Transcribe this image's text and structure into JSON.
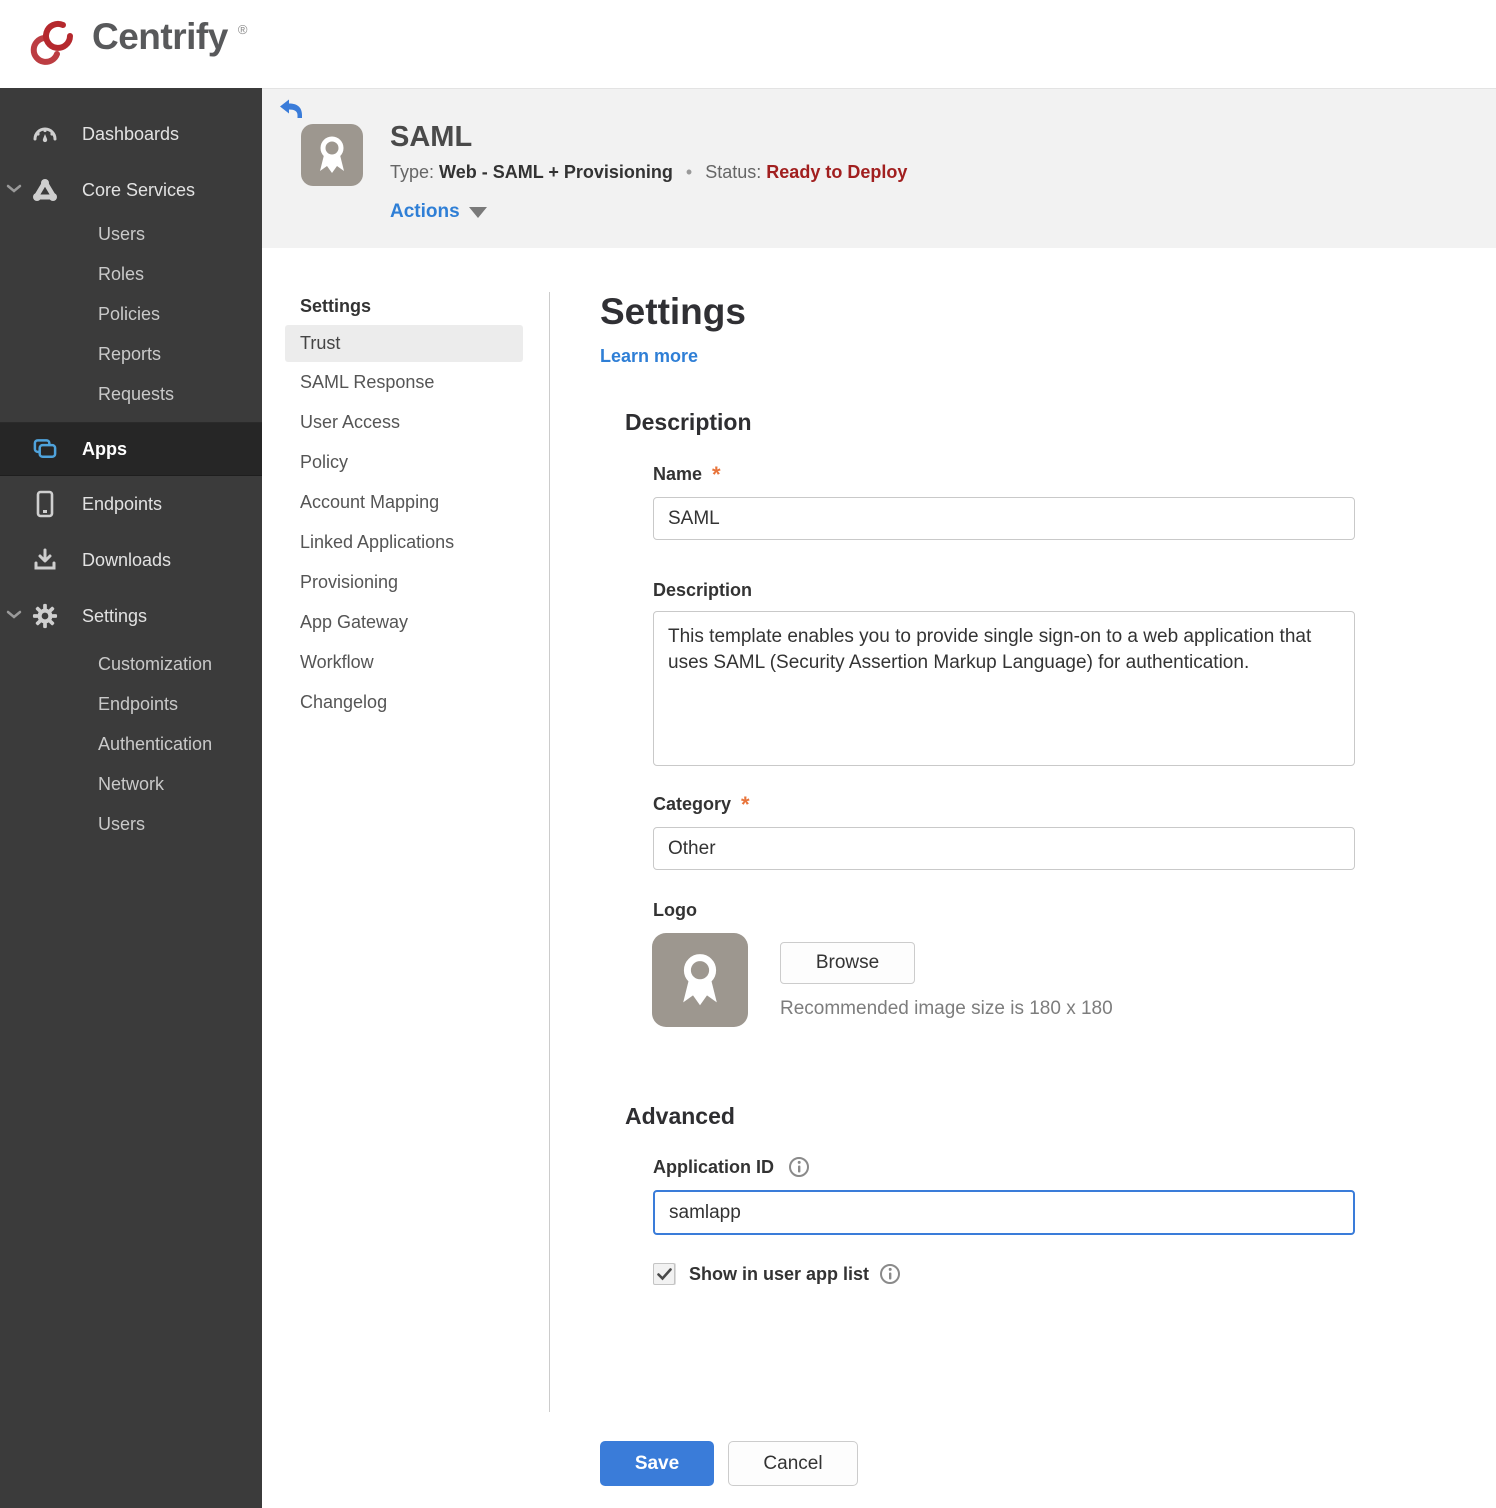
{
  "brand": {
    "name": "Centrify",
    "reg": "®"
  },
  "colors": {
    "accent_blue": "#3a7cd9",
    "link_blue": "#2f7fd6",
    "status_red": "#a11f1f",
    "required_orange": "#e8743b",
    "sidebar_bg": "#3b3b3b",
    "sidebar_selected_bg": "#262626",
    "apps_icon_blue": "#4fa3dc",
    "band_bg": "#f2f2f2",
    "logo_gray": "#9d978f"
  },
  "sidebar": {
    "items": [
      {
        "label": "Dashboards"
      },
      {
        "label": "Core Services"
      },
      {
        "label": "Users"
      },
      {
        "label": "Roles"
      },
      {
        "label": "Policies"
      },
      {
        "label": "Reports"
      },
      {
        "label": "Requests"
      },
      {
        "label": "Apps"
      },
      {
        "label": "Endpoints"
      },
      {
        "label": "Downloads"
      },
      {
        "label": "Settings"
      },
      {
        "label": "Customization"
      },
      {
        "label": "Endpoints"
      },
      {
        "label": "Authentication"
      },
      {
        "label": "Network"
      },
      {
        "label": "Users"
      }
    ],
    "selected": "Apps"
  },
  "app_header": {
    "title": "SAML",
    "type_label": "Type:",
    "type_value": "Web - SAML + Provisioning",
    "separator": "•",
    "status_label": "Status:",
    "status_value": "Ready to Deploy",
    "actions_label": "Actions"
  },
  "subnav": {
    "header": "Settings",
    "selected": "Trust",
    "items": [
      {
        "label": "Trust"
      },
      {
        "label": "SAML Response"
      },
      {
        "label": "User Access"
      },
      {
        "label": "Policy"
      },
      {
        "label": "Account Mapping"
      },
      {
        "label": "Linked Applications"
      },
      {
        "label": "Provisioning"
      },
      {
        "label": "App Gateway"
      },
      {
        "label": "Workflow"
      },
      {
        "label": "Changelog"
      }
    ]
  },
  "form": {
    "title": "Settings",
    "learn_more": "Learn more",
    "required_mark": "*",
    "description": {
      "heading": "Description",
      "name_label": "Name",
      "name_value": "SAML",
      "desc_label": "Description",
      "desc_value": "This template enables you to provide single sign-on to a web application that uses SAML (Security Assertion Markup Language) for authentication.",
      "category_label": "Category",
      "category_value": "Other",
      "logo_label": "Logo",
      "browse_label": "Browse",
      "logo_hint": "Recommended image size is 180 x 180"
    },
    "advanced": {
      "heading": "Advanced",
      "app_id_label": "Application ID",
      "app_id_value": "samlapp",
      "show_label": "Show in user app list",
      "show_checked": true
    },
    "buttons": {
      "save": "Save",
      "cancel": "Cancel"
    }
  }
}
